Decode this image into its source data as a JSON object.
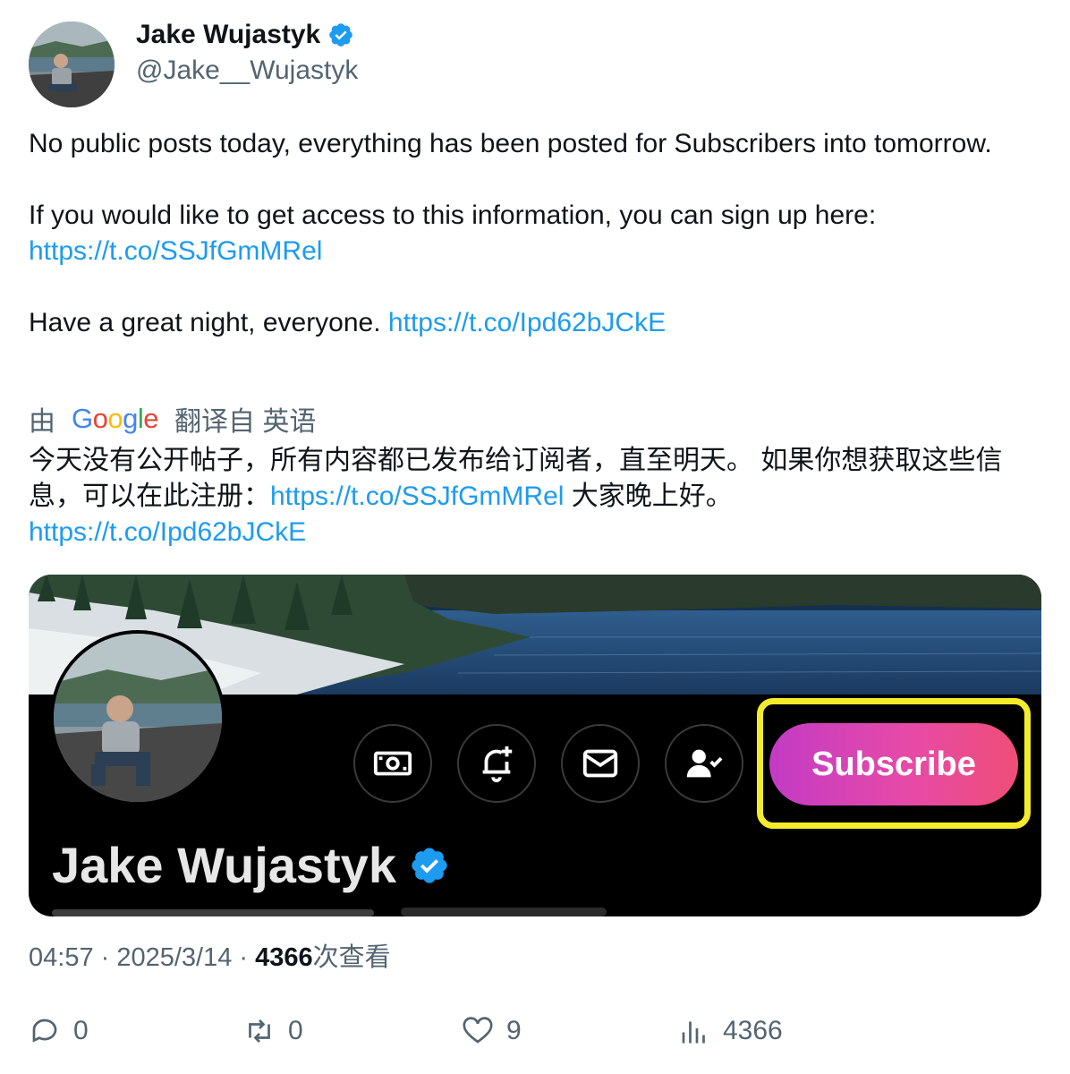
{
  "author": {
    "name": "Jake Wujastyk",
    "handle": "@Jake__Wujastyk",
    "verified": true
  },
  "post": {
    "line1": "No public posts today, everything has been posted for Subscribers into tomorrow.",
    "line2": "If you would like to get access to this information, you can sign up here:",
    "link1": "https://t.co/SSJfGmMRel",
    "line3": "Have a great night, everyone.",
    "link2": "https://t.co/Ipd62bJCkE"
  },
  "translation_bar": {
    "prefix": "由",
    "provider": "Google",
    "suffix": "翻译自 英语"
  },
  "translation": {
    "text1": "今天没有公开帖子，所有内容都已发布给订阅者，直至明天。 如果你想获取这些信息，可以在此注册：",
    "link1": "https://t.co/SSJfGmMRel",
    "text2": " 大家晚上好。",
    "link2": "https://t.co/Ipd62bJCkE"
  },
  "media": {
    "profile_name": "Jake Wujastyk",
    "subscribe_label": "Subscribe",
    "icons": [
      "money-icon",
      "bell-plus-icon",
      "mail-icon",
      "person-check-icon"
    ],
    "highlight_color": "#f4ec2a"
  },
  "meta": {
    "time": "04:57",
    "separator": " · ",
    "date": "2025/3/14",
    "views_count": "4366",
    "views_label": "次查看"
  },
  "actions": {
    "replies": "0",
    "reposts": "0",
    "likes": "9",
    "views": "4366"
  },
  "colors": {
    "link": "#1d9bf0",
    "verified": "#1d9bf0",
    "muted": "#536471"
  }
}
